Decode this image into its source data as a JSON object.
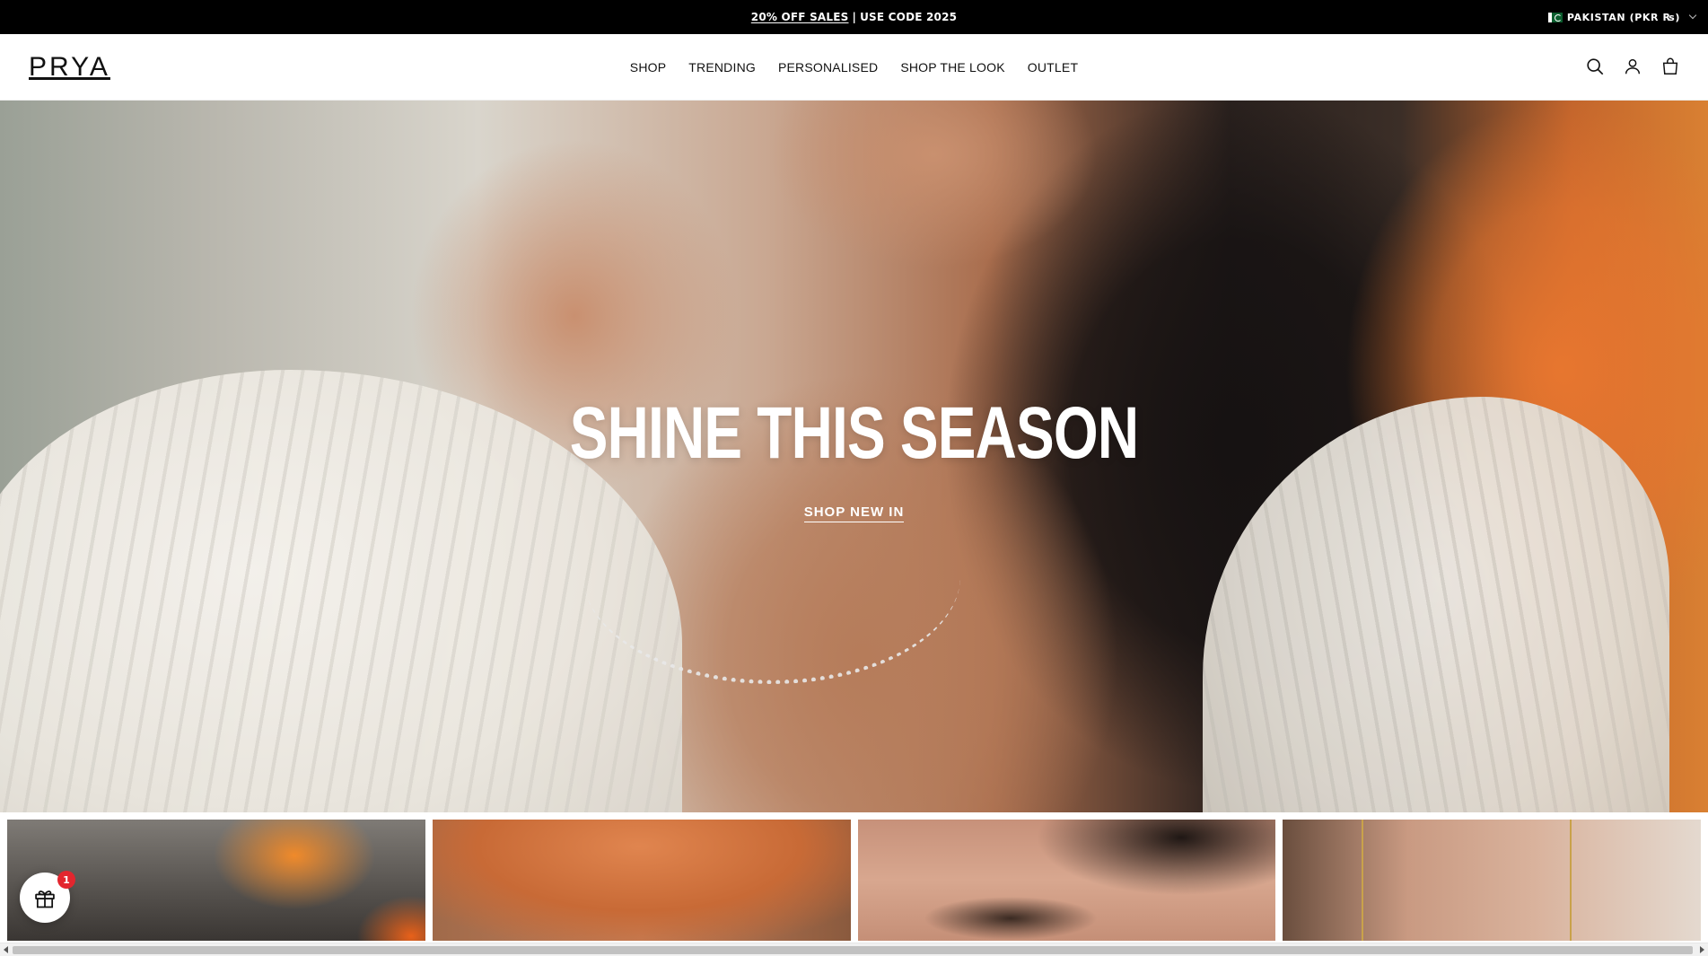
{
  "announcement": {
    "promo_link": "20% OFF SALES",
    "separator": "|",
    "promo_text": "USE CODE 2025",
    "country_selector": "PAKISTAN (PKR ₨)"
  },
  "header": {
    "logo": "PRYA",
    "nav": [
      "SHOP",
      "TRENDING",
      "PERSONALISED",
      "SHOP THE LOOK",
      "OUTLET"
    ],
    "icons": [
      "search-icon",
      "account-icon",
      "cart-icon"
    ]
  },
  "hero": {
    "title": "SHINE THIS SEASON",
    "cta": "SHOP NEW IN"
  },
  "gift_widget": {
    "badge_count": "1"
  },
  "colors": {
    "announcement_bg": "#000000",
    "header_bg": "#ffffff",
    "badge": "#e3262e",
    "hero_text": "#ffffff"
  }
}
